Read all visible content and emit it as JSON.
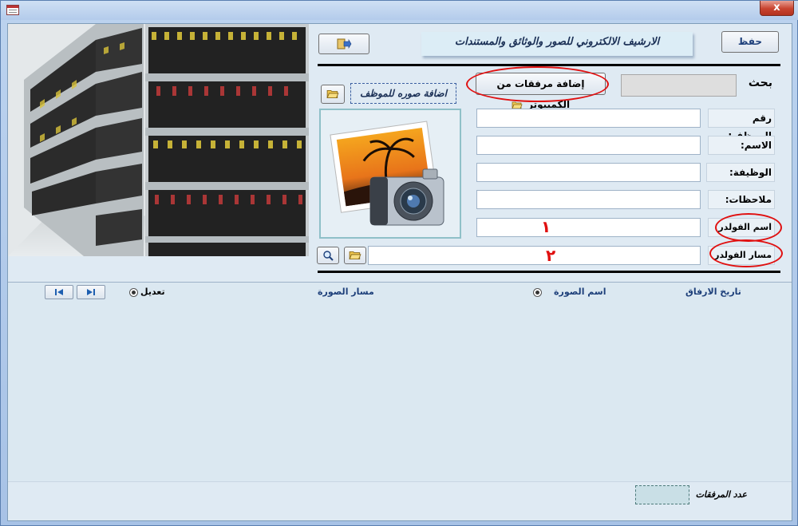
{
  "window": {
    "close_glyph": "x"
  },
  "toolbar": {
    "save_label": "حفظ",
    "exit_icon": "exit-icon",
    "title": "الارشيف  الالكتروني للصور  والوثائق والمستندات"
  },
  "search": {
    "label": "بحث",
    "value": ""
  },
  "attach_button": {
    "label": "إضافة مرفقات من الكمبيوتر",
    "icon": "folder-open-icon"
  },
  "employee_photo": {
    "label": "اضافة صوره للموظف",
    "icon": "folder-open-icon"
  },
  "fields": {
    "employee_no": {
      "label": "رقم الموظف:",
      "value": ""
    },
    "name": {
      "label": "الاسم:",
      "value": ""
    },
    "job": {
      "label": "الوظيفة:",
      "value": ""
    },
    "notes": {
      "label": "ملاحظات:",
      "value": ""
    },
    "folder_name": {
      "label": "اسم الفولدر",
      "value": ""
    },
    "folder_path": {
      "label": "مسار الفولدر",
      "value": ""
    }
  },
  "annotations": {
    "one": "١",
    "two": "٢"
  },
  "detail": {
    "col_attach_date": "تاريخ الارفاق",
    "col_image_name": "اسم الصورة",
    "col_image_path": "مسار الصورة",
    "col_edit": "تعديل",
    "nav_first": "⏮",
    "nav_last": "⏭"
  },
  "footer": {
    "count_label": "عدد المرفقات",
    "count_value": ""
  }
}
